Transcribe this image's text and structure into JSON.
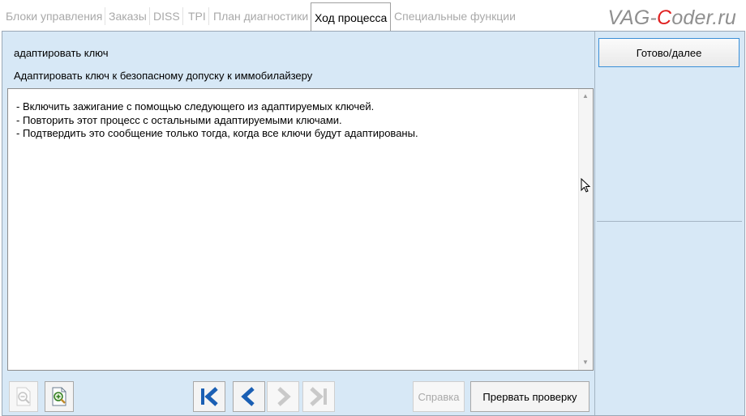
{
  "tabs": [
    {
      "label": "Блоки управления",
      "active": false
    },
    {
      "label": "Заказы",
      "active": false
    },
    {
      "label": "DISS",
      "active": false
    },
    {
      "label": "TPI",
      "active": false
    },
    {
      "label": "План диагностики",
      "active": false
    },
    {
      "label": "Ход процесса",
      "active": true
    },
    {
      "label": "Специальные функции",
      "active": false
    }
  ],
  "logo": {
    "part1": "VAG-",
    "part2": "C",
    "part3": "oder.ru"
  },
  "header": {
    "title": "адаптировать ключ",
    "subtitle": "Адаптировать ключ к безопасному допуску к иммобилайзеру"
  },
  "content": {
    "lines": [
      "- Включить зажигание с помощью следующего из адаптируемых ключей.",
      "- Повторить этот процесс с остальными адаптируемыми ключами.",
      "- Подтвердить это сообщение только тогда, когда все ключи будут адаптированы."
    ]
  },
  "toolbar": {
    "help_label": "Справка",
    "abort_label": "Прервать проверку"
  },
  "right_panel": {
    "done_label": "Готово/далее"
  },
  "colors": {
    "panel_bg": "#d7e8f6",
    "accent_blue": "#1a5fb4",
    "focus_border": "#3a8fd8",
    "logo_red": "#e02020"
  },
  "icons": [
    "zoom-out-icon",
    "zoom-in-icon",
    "first-icon",
    "back-icon",
    "forward-icon",
    "last-icon"
  ]
}
